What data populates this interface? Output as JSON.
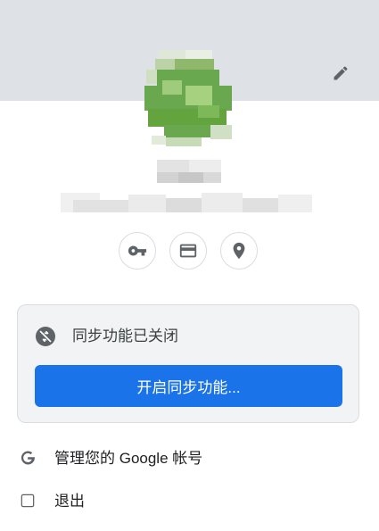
{
  "profile": {
    "edit_icon": "pencil-icon",
    "avatar_color": "#6aa84f"
  },
  "quick_actions": [
    {
      "icon": "key-icon"
    },
    {
      "icon": "credit-card-icon"
    },
    {
      "icon": "location-pin-icon"
    }
  ],
  "sync": {
    "icon": "sync-off-icon",
    "status": "同步功能已关闭",
    "button_label": "开启同步功能...",
    "button_color": "#1a73e8"
  },
  "menu": {
    "manage_account": {
      "icon": "google-g-icon",
      "label": "管理您的 Google 帐号"
    },
    "sign_out": {
      "icon": "sign-out-icon",
      "label": "退出"
    }
  },
  "colors": {
    "header_band": "#dee1e6",
    "card_background": "#f1f3f4",
    "accent": "#1a73e8"
  }
}
